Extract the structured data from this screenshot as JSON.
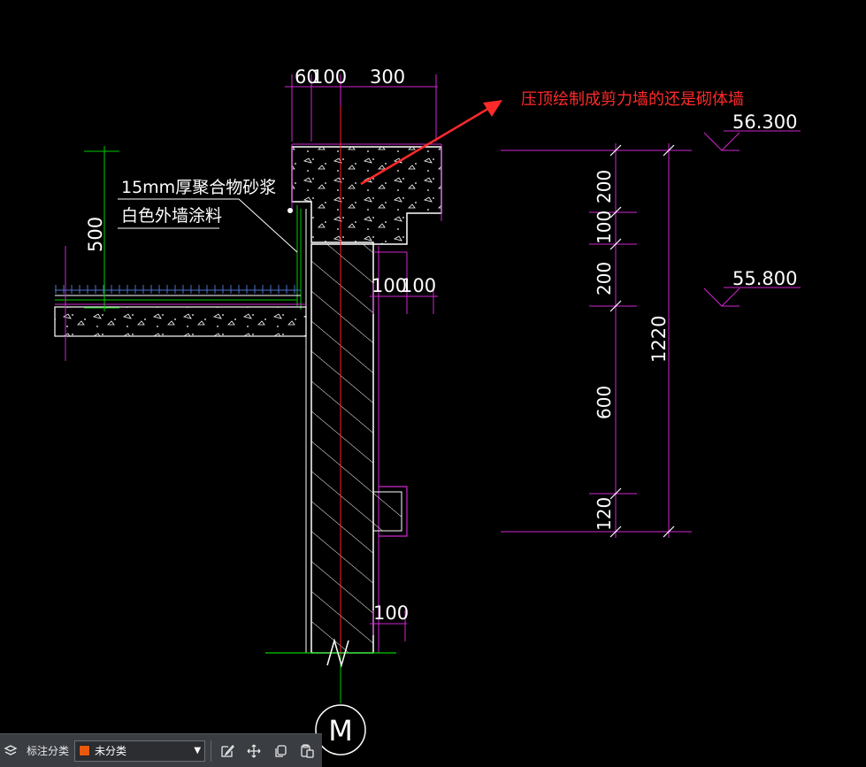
{
  "drawing": {
    "top_dims": [
      "60",
      "100",
      "300"
    ],
    "right_dims": [
      "100",
      "100"
    ],
    "bottom_dim": "100",
    "left_dim": "500",
    "chain_dims": [
      "200",
      "100",
      "200",
      "600",
      "120"
    ],
    "total_dim": "1220",
    "elevations": [
      "56.300",
      "55.800"
    ],
    "notes": [
      "15mm厚聚合物砂浆",
      "白色外墙涂料"
    ],
    "annotation": "压顶绘制成剪力墙的还是砌体墙",
    "view_symbol": "M"
  },
  "toolbar": {
    "category_label": "标注分类",
    "category_value": "未分类",
    "category_color": "#e8590c",
    "icons": [
      "layers-icon",
      "edit-icon",
      "move-icon",
      "copy-icon",
      "paste-icon"
    ]
  },
  "colors": {
    "background": "#000000",
    "dimension": "#d026d0",
    "axis": "#ff2222",
    "leader": "#00cc00",
    "outline": "#ffffff",
    "annotation": "#ff2a2a"
  }
}
